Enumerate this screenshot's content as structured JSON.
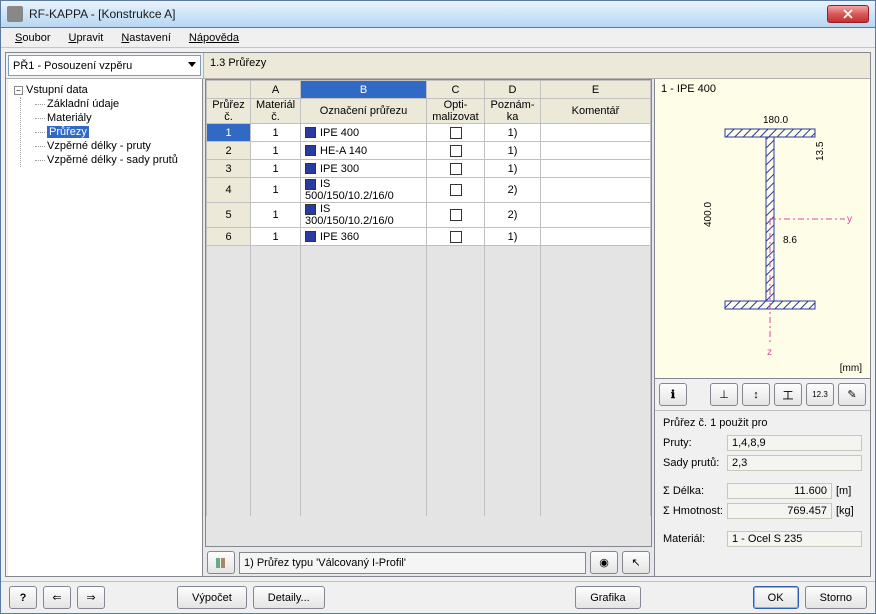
{
  "window": {
    "title": "RF-KAPPA - [Konstrukce A]"
  },
  "menu": {
    "soubor": "Soubor",
    "upravit": "Upravit",
    "nastaveni": "Nastavení",
    "napoveda": "Nápověda"
  },
  "combo": {
    "value": "PŘ1 - Posouzení vzpěru"
  },
  "section": {
    "title": "1.3 Průřezy"
  },
  "tree": {
    "root": "Vstupní data",
    "items": [
      {
        "label": "Základní údaje"
      },
      {
        "label": "Materiály"
      },
      {
        "label": "Průřezy",
        "selected": true
      },
      {
        "label": "Vzpěrné délky - pruty"
      },
      {
        "label": "Vzpěrné délky - sady prutů"
      }
    ]
  },
  "grid": {
    "letters": [
      "A",
      "B",
      "C",
      "D",
      "E"
    ],
    "headers": {
      "sec": "Průřez č.",
      "mat": "Materiál č.",
      "name": "Označení průřezu",
      "opt": "Opti- malizovat",
      "note": "Poznám- ka",
      "comment": "Komentář"
    },
    "rows": [
      {
        "n": "1",
        "mat": "1",
        "name": "IPE 400",
        "note": "1)",
        "sel": true
      },
      {
        "n": "2",
        "mat": "1",
        "name": "HE-A 140",
        "note": "1)"
      },
      {
        "n": "3",
        "mat": "1",
        "name": "IPE 300",
        "note": "1)"
      },
      {
        "n": "4",
        "mat": "1",
        "name": "IS 500/150/10.2/16/0",
        "note": "2)"
      },
      {
        "n": "5",
        "mat": "1",
        "name": "IS 300/150/10.2/16/0",
        "note": "2)"
      },
      {
        "n": "6",
        "mat": "1",
        "name": "IPE 360",
        "note": "1)"
      }
    ]
  },
  "status": {
    "text": "1) Průřez typu 'Válcovaný I-Profil'"
  },
  "preview": {
    "title": "1 - IPE 400",
    "width": "180.0",
    "height": "400.0",
    "tf": "13.5",
    "tw": "8.6",
    "unit": "[mm]"
  },
  "info": {
    "title": "Průřez č. 1 použit pro",
    "pruty_lbl": "Pruty:",
    "pruty_val": "1,4,8,9",
    "sady_lbl": "Sady prutů:",
    "sady_val": "2,3",
    "delka_lbl": "Σ Délka:",
    "delka_val": "11.600",
    "delka_unit": "[m]",
    "hmot_lbl": "Σ Hmotnost:",
    "hmot_val": "769.457",
    "hmot_unit": "[kg]",
    "mat_lbl": "Materiál:",
    "mat_val": "1 - Ocel S 235"
  },
  "buttons": {
    "vypocet": "Výpočet",
    "detaily": "Detaily...",
    "grafika": "Grafika",
    "ok": "OK",
    "storno": "Storno"
  },
  "icons": {
    "library": "lib",
    "info": "i",
    "eye": "👁",
    "pick": "↖",
    "toolbar": [
      "ℹ",
      "⎆",
      "↧",
      "⇔",
      "123",
      "⚙"
    ]
  },
  "chart_data": {
    "type": "table",
    "title": "1.3 Průřezy",
    "columns": [
      "Průřez č.",
      "Materiál č.",
      "Označení průřezu",
      "Optimalizovat",
      "Poznámka",
      "Komentář"
    ],
    "rows": [
      [
        1,
        1,
        "IPE 400",
        false,
        "1)",
        ""
      ],
      [
        2,
        1,
        "HE-A 140",
        false,
        "1)",
        ""
      ],
      [
        3,
        1,
        "IPE 300",
        false,
        "1)",
        ""
      ],
      [
        4,
        1,
        "IS 500/150/10.2/16/0",
        false,
        "2)",
        ""
      ],
      [
        5,
        1,
        "IS 300/150/10.2/16/0",
        false,
        "2)",
        ""
      ],
      [
        6,
        1,
        "IPE 360",
        false,
        "1)",
        ""
      ]
    ]
  }
}
